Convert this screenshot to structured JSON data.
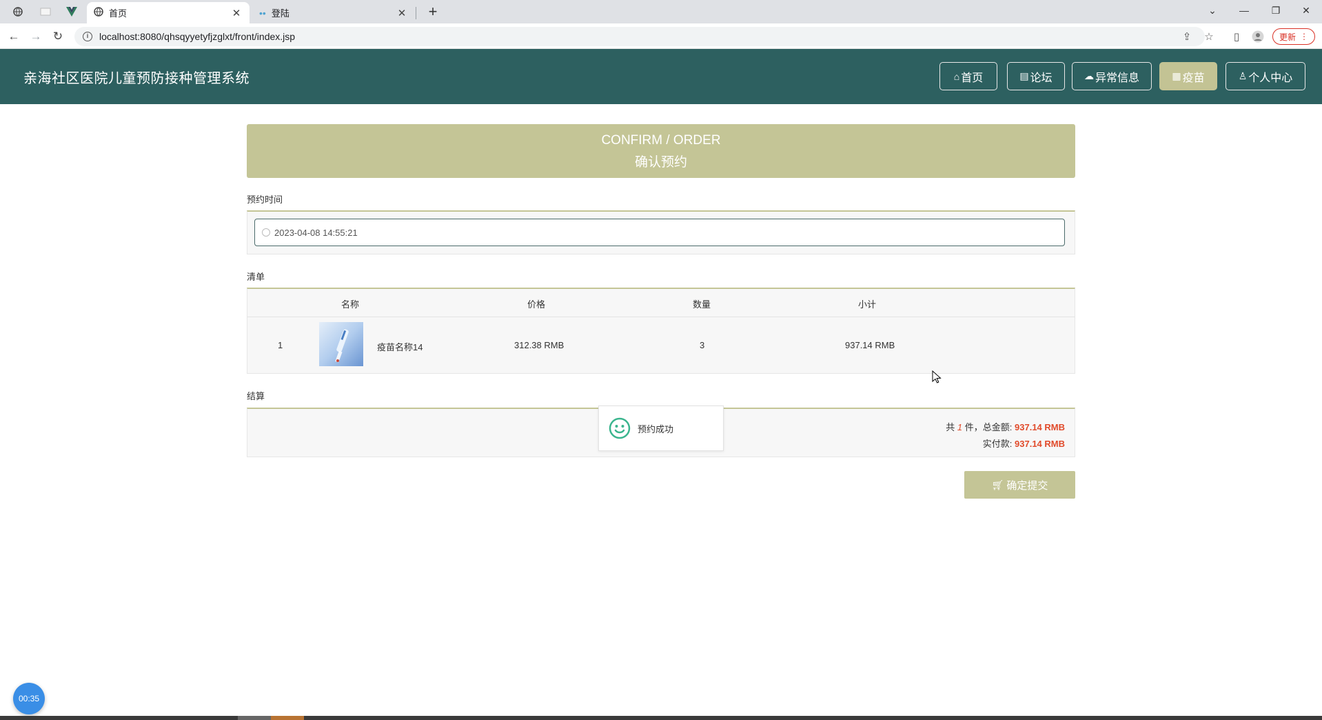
{
  "browser": {
    "tabs": [
      {
        "title": "首页",
        "active": true
      },
      {
        "title": "登陆",
        "active": false
      }
    ],
    "url": "localhost:8080/qhsqyyetyfjzglxt/front/index.jsp",
    "update_label": "更新"
  },
  "header": {
    "site_title": "亲海社区医院儿童预防接种管理系统",
    "nav": [
      {
        "label": "首页",
        "icon": "home-icon",
        "active": false
      },
      {
        "label": "论坛",
        "icon": "forum-icon",
        "active": false
      },
      {
        "label": "异常信息",
        "icon": "cloud-icon",
        "active": false
      },
      {
        "label": "疫苗",
        "icon": "grid-icon",
        "active": true
      },
      {
        "label": "个人中心",
        "icon": "user-icon",
        "active": false
      }
    ]
  },
  "banner": {
    "title_en": "CONFIRM / ORDER",
    "title_cn": "确认预约"
  },
  "appointment": {
    "label": "预约时间",
    "value": "2023-04-08 14:55:21"
  },
  "order_list": {
    "label": "清单",
    "columns": [
      "名称",
      "价格",
      "数量",
      "小计"
    ],
    "rows": [
      {
        "index": "1",
        "name": "疫苗名称14",
        "price": "312.38 RMB",
        "quantity": "3",
        "subtotal": "937.14 RMB"
      }
    ]
  },
  "checkout": {
    "label": "结算",
    "total_prefix": "共",
    "count": "1",
    "total_mid": "件，总金额:",
    "total_amount": "937.14 RMB",
    "paid_label": "实付款:",
    "paid_amount": "937.14 RMB"
  },
  "toast": {
    "message": "预约成功"
  },
  "submit": {
    "label": "确定提交"
  },
  "timer": {
    "value": "00:35"
  },
  "colors": {
    "header_bg": "#2d6060",
    "accent": "#c4c596",
    "price_red": "#e14b2b"
  }
}
